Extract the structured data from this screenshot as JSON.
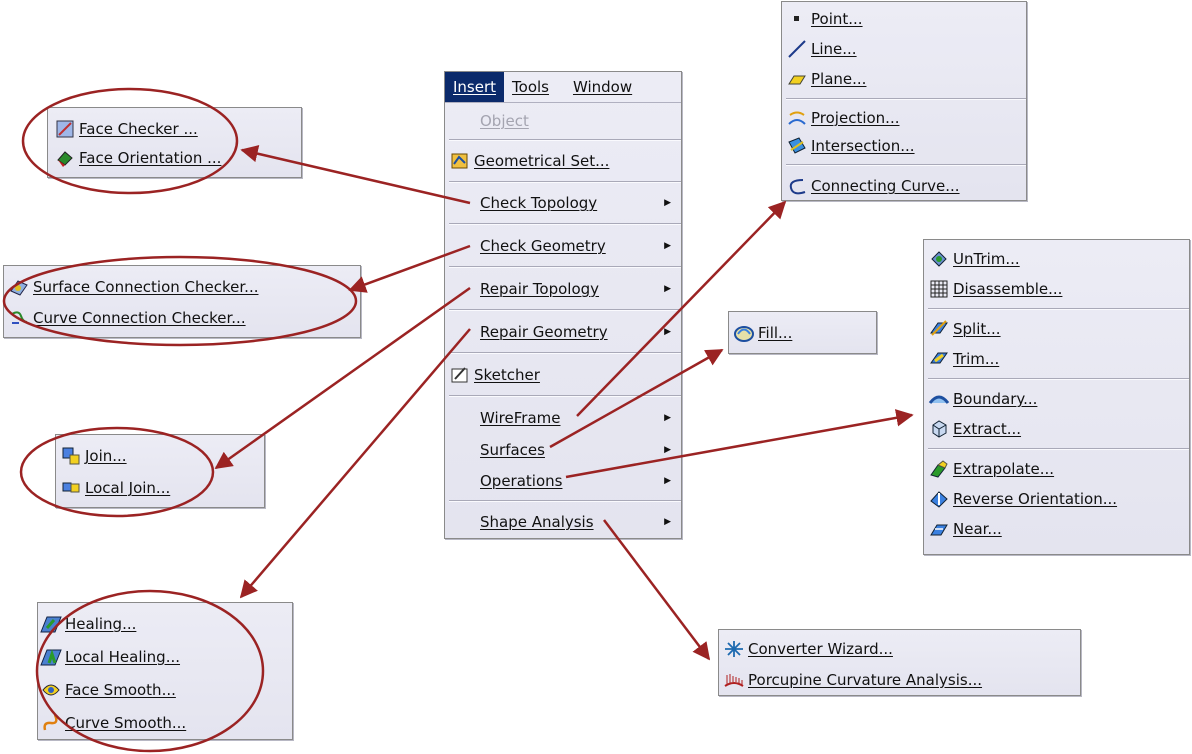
{
  "main_menu": {
    "bar": [
      "Insert",
      "Tools",
      "Window"
    ],
    "items": [
      {
        "label": "Object",
        "icon": "none",
        "disabled": true
      },
      {
        "label": "Geometrical Set...",
        "icon": "geometrical-set-icon"
      },
      {
        "label": "Check Topology",
        "submenu": true
      },
      {
        "label": "Check Geometry",
        "submenu": true
      },
      {
        "label": "Repair Topology",
        "submenu": true
      },
      {
        "label": "Repair Geometry",
        "submenu": true
      },
      {
        "label": "Sketcher",
        "icon": "sketcher-icon"
      },
      {
        "label": "WireFrame",
        "submenu": true
      },
      {
        "label": "Surfaces",
        "submenu": true
      },
      {
        "label": "Operations",
        "submenu": true
      },
      {
        "label": "Shape Analysis",
        "submenu": true
      }
    ]
  },
  "check_topology": [
    "Face Checker ...",
    "Face Orientation ..."
  ],
  "check_geometry": [
    "Surface Connection Checker...",
    "Curve Connection Checker..."
  ],
  "repair_topology": [
    "Join...",
    "Local Join..."
  ],
  "repair_geometry": [
    "Healing...",
    "Local Healing...",
    "Face Smooth...",
    "Curve Smooth..."
  ],
  "wireframe": [
    "Point...",
    "Line...",
    "Plane...",
    "Projection...",
    "Intersection...",
    "Connecting Curve..."
  ],
  "surfaces": [
    "Fill..."
  ],
  "operations": [
    "UnTrim...",
    "Disassemble...",
    "Split...",
    "Trim...",
    "Boundary...",
    "Extract...",
    "Extrapolate...",
    "Reverse Orientation...",
    "Near..."
  ],
  "shape_analysis": [
    "Converter Wizard...",
    "Porcupine Curvature Analysis..."
  ],
  "colors": {
    "arrow": "#9b2323",
    "menu_bg": "#e8e8f2",
    "active": "#0b2a6b"
  }
}
